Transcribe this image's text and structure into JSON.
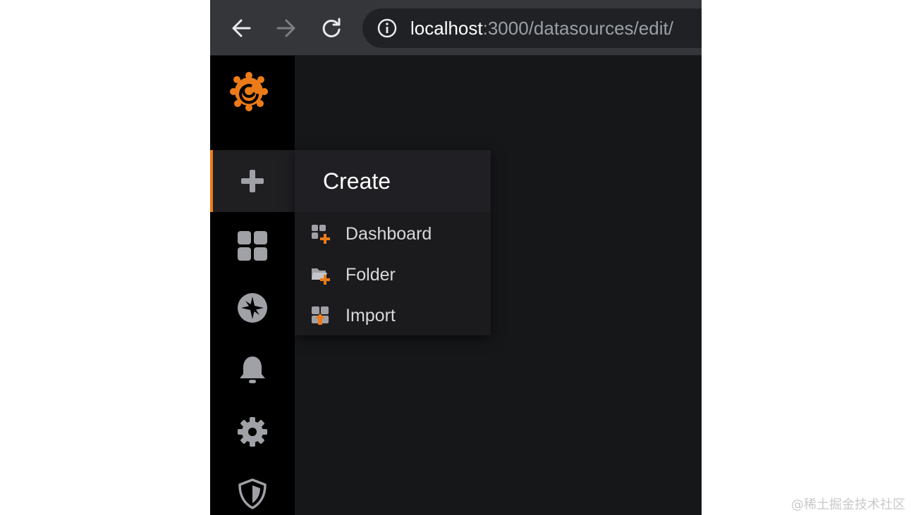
{
  "browser": {
    "url_host": "localhost",
    "url_rest": ":3000/datasources/edit/",
    "icons": {
      "back": "arrow-left-icon",
      "forward": "arrow-right-icon",
      "reload": "reload-icon",
      "info": "info-icon"
    }
  },
  "sidebar": {
    "logo": "grafana-logo",
    "items": [
      {
        "icon": "plus-icon",
        "active": true
      },
      {
        "icon": "dashboards-grid-icon"
      },
      {
        "icon": "compass-icon"
      },
      {
        "icon": "bell-icon"
      },
      {
        "icon": "gear-icon"
      },
      {
        "icon": "shield-icon"
      }
    ]
  },
  "create_menu": {
    "title": "Create",
    "items": [
      {
        "label": "Dashboard",
        "icon": "dashboard-add-icon"
      },
      {
        "label": "Folder",
        "icon": "folder-add-icon"
      },
      {
        "label": "Import",
        "icon": "import-icon"
      }
    ]
  },
  "watermark": "@稀土掘金技术社区",
  "colors": {
    "accent": "#eb7b18",
    "sidebar_bg": "#000000",
    "page_bg": "#161719",
    "toolbar_bg": "#35363a"
  }
}
